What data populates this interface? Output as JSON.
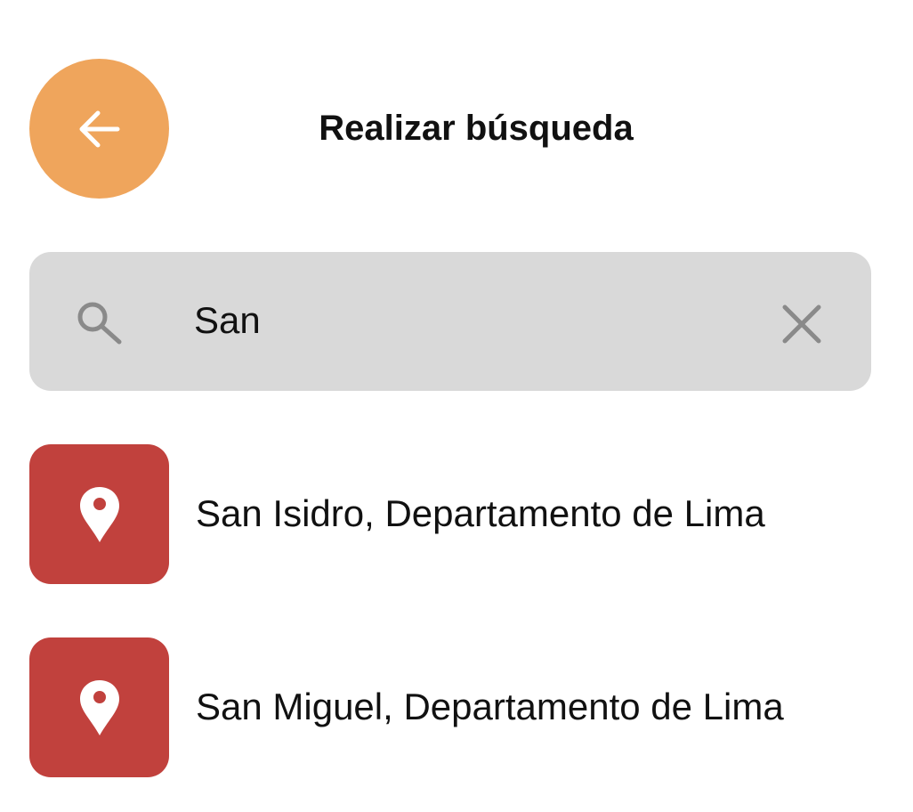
{
  "header": {
    "title": "Realizar búsqueda",
    "back_icon": "arrow-left-icon"
  },
  "search": {
    "value": "San",
    "search_icon": "search-icon",
    "clear_icon": "close-icon"
  },
  "results": [
    {
      "label": "San Isidro, Departamento de Lima",
      "icon": "map-pin-icon"
    },
    {
      "label": "San Miguel, Departamento de Lima",
      "icon": "map-pin-icon"
    }
  ],
  "colors": {
    "back_button": "#EFA55C",
    "search_background": "#D9D9D9",
    "search_icon": "#8A8A8A",
    "result_icon_background": "#C1413D",
    "icon_foreground": "#FFFFFF"
  }
}
